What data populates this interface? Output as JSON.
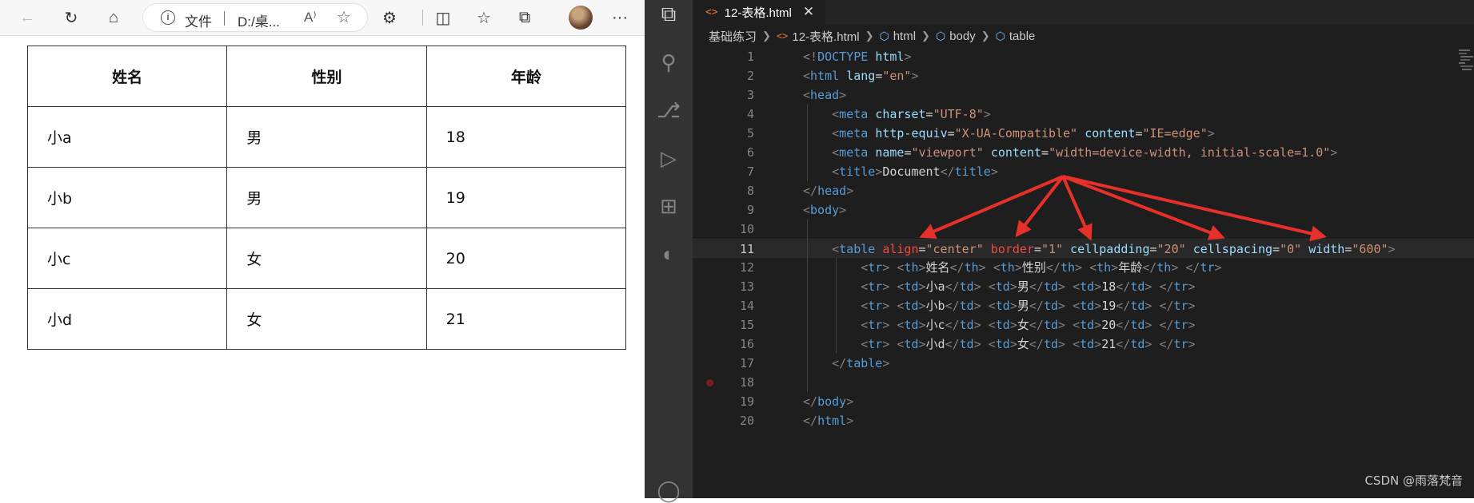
{
  "browser": {
    "toolbar": {
      "back_icon": "←",
      "refresh_icon": "↻",
      "home_icon": "⌂",
      "address_label": "文件",
      "address_url": "D:/桌...",
      "read_aloud_label": "A⁾",
      "favorite_icon": "☆",
      "extensions_icon": "⚙",
      "split_icon": "◫",
      "favorites_icon": "☆",
      "collections_icon": "⧉",
      "more_icon": "···"
    },
    "table": {
      "headers": [
        "姓名",
        "性别",
        "年龄"
      ],
      "rows": [
        [
          "小a",
          "男",
          "18"
        ],
        [
          "小b",
          "男",
          "19"
        ],
        [
          "小c",
          "女",
          "20"
        ],
        [
          "小d",
          "女",
          "21"
        ]
      ]
    }
  },
  "vscode": {
    "tab": {
      "label": "12-表格.html",
      "close": "✕"
    },
    "breadcrumb": [
      "基础练习",
      "12-表格.html",
      "html",
      "body",
      "table"
    ],
    "watermark": "CSDN @雨落梵音",
    "colors": {
      "arrow": "#e8302a",
      "keyword": "#569cd6",
      "attr": "#9cdcfe",
      "string": "#ce9178"
    },
    "lines": [
      {
        "n": "1",
        "tokens": [
          [
            "pn",
            "<!"
          ],
          [
            "tg",
            "DOCTYPE"
          ],
          [
            "tx",
            " "
          ],
          [
            "at",
            "html"
          ],
          [
            "pn",
            ">"
          ]
        ]
      },
      {
        "n": "2",
        "tokens": [
          [
            "pn",
            "<"
          ],
          [
            "tg",
            "html"
          ],
          [
            "tx",
            " "
          ],
          [
            "at",
            "lang"
          ],
          [
            "tx",
            "="
          ],
          [
            "st",
            "\"en\""
          ],
          [
            "pn",
            ">"
          ]
        ]
      },
      {
        "n": "3",
        "tokens": [
          [
            "pn",
            "<"
          ],
          [
            "tg",
            "head"
          ],
          [
            "pn",
            ">"
          ]
        ]
      },
      {
        "n": "4",
        "tokens": [
          [
            "tx",
            "    "
          ],
          [
            "pn",
            "<"
          ],
          [
            "tg",
            "meta"
          ],
          [
            "tx",
            " "
          ],
          [
            "at",
            "charset"
          ],
          [
            "tx",
            "="
          ],
          [
            "st",
            "\"UTF-8\""
          ],
          [
            "pn",
            ">"
          ]
        ]
      },
      {
        "n": "5",
        "tokens": [
          [
            "tx",
            "    "
          ],
          [
            "pn",
            "<"
          ],
          [
            "tg",
            "meta"
          ],
          [
            "tx",
            " "
          ],
          [
            "at",
            "http-equiv"
          ],
          [
            "tx",
            "="
          ],
          [
            "st",
            "\"X-UA-Compatible\""
          ],
          [
            "tx",
            " "
          ],
          [
            "at",
            "content"
          ],
          [
            "tx",
            "="
          ],
          [
            "st",
            "\"IE=edge\""
          ],
          [
            "pn",
            ">"
          ]
        ]
      },
      {
        "n": "6",
        "tokens": [
          [
            "tx",
            "    "
          ],
          [
            "pn",
            "<"
          ],
          [
            "tg",
            "meta"
          ],
          [
            "tx",
            " "
          ],
          [
            "at",
            "name"
          ],
          [
            "tx",
            "="
          ],
          [
            "st",
            "\"viewport\""
          ],
          [
            "tx",
            " "
          ],
          [
            "at",
            "content"
          ],
          [
            "tx",
            "="
          ],
          [
            "st",
            "\"width=device-width, initial-scale=1.0\""
          ],
          [
            "pn",
            ">"
          ]
        ]
      },
      {
        "n": "7",
        "tokens": [
          [
            "tx",
            "    "
          ],
          [
            "pn",
            "<"
          ],
          [
            "tg",
            "title"
          ],
          [
            "pn",
            ">"
          ],
          [
            "tx",
            "Document"
          ],
          [
            "pn",
            "</"
          ],
          [
            "tg",
            "title"
          ],
          [
            "pn",
            ">"
          ]
        ]
      },
      {
        "n": "8",
        "tokens": [
          [
            "pn",
            "</"
          ],
          [
            "tg",
            "head"
          ],
          [
            "pn",
            ">"
          ]
        ]
      },
      {
        "n": "9",
        "tokens": [
          [
            "pn",
            "<"
          ],
          [
            "tg",
            "body"
          ],
          [
            "pn",
            ">"
          ]
        ]
      },
      {
        "n": "10",
        "tokens": []
      },
      {
        "n": "11",
        "tokens": [
          [
            "tx",
            "    "
          ],
          [
            "pn",
            "<"
          ],
          [
            "tg",
            "table"
          ],
          [
            "tx",
            " "
          ],
          [
            "ac",
            "align"
          ],
          [
            "tx",
            "="
          ],
          [
            "st",
            "\"center\""
          ],
          [
            "tx",
            " "
          ],
          [
            "ac",
            "border"
          ],
          [
            "tx",
            "="
          ],
          [
            "st",
            "\"1\""
          ],
          [
            "tx",
            " "
          ],
          [
            "at",
            "cellpadding"
          ],
          [
            "tx",
            "="
          ],
          [
            "st",
            "\"20\""
          ],
          [
            "tx",
            " "
          ],
          [
            "at",
            "cellspacing"
          ],
          [
            "tx",
            "="
          ],
          [
            "st",
            "\"0\""
          ],
          [
            "tx",
            " "
          ],
          [
            "at",
            "width"
          ],
          [
            "tx",
            "="
          ],
          [
            "st",
            "\"600\""
          ],
          [
            "pn",
            ">"
          ]
        ]
      },
      {
        "n": "12",
        "tokens": [
          [
            "tx",
            "        "
          ],
          [
            "pn",
            "<"
          ],
          [
            "tg",
            "tr"
          ],
          [
            "pn",
            ">"
          ],
          [
            "tx",
            " "
          ],
          [
            "pn",
            "<"
          ],
          [
            "tg",
            "th"
          ],
          [
            "pn",
            ">"
          ],
          [
            "tx",
            "姓名"
          ],
          [
            "pn",
            "</"
          ],
          [
            "tg",
            "th"
          ],
          [
            "pn",
            ">"
          ],
          [
            "tx",
            " "
          ],
          [
            "pn",
            "<"
          ],
          [
            "tg",
            "th"
          ],
          [
            "pn",
            ">"
          ],
          [
            "tx",
            "性别"
          ],
          [
            "pn",
            "</"
          ],
          [
            "tg",
            "th"
          ],
          [
            "pn",
            ">"
          ],
          [
            "tx",
            " "
          ],
          [
            "pn",
            "<"
          ],
          [
            "tg",
            "th"
          ],
          [
            "pn",
            ">"
          ],
          [
            "tx",
            "年龄"
          ],
          [
            "pn",
            "</"
          ],
          [
            "tg",
            "th"
          ],
          [
            "pn",
            ">"
          ],
          [
            "tx",
            " "
          ],
          [
            "pn",
            "</"
          ],
          [
            "tg",
            "tr"
          ],
          [
            "pn",
            ">"
          ]
        ]
      },
      {
        "n": "13",
        "tokens": [
          [
            "tx",
            "        "
          ],
          [
            "pn",
            "<"
          ],
          [
            "tg",
            "tr"
          ],
          [
            "pn",
            ">"
          ],
          [
            "tx",
            " "
          ],
          [
            "pn",
            "<"
          ],
          [
            "tg",
            "td"
          ],
          [
            "pn",
            ">"
          ],
          [
            "tx",
            "小a"
          ],
          [
            "pn",
            "</"
          ],
          [
            "tg",
            "td"
          ],
          [
            "pn",
            ">"
          ],
          [
            "tx",
            " "
          ],
          [
            "pn",
            "<"
          ],
          [
            "tg",
            "td"
          ],
          [
            "pn",
            ">"
          ],
          [
            "tx",
            "男"
          ],
          [
            "pn",
            "</"
          ],
          [
            "tg",
            "td"
          ],
          [
            "pn",
            ">"
          ],
          [
            "tx",
            " "
          ],
          [
            "pn",
            "<"
          ],
          [
            "tg",
            "td"
          ],
          [
            "pn",
            ">"
          ],
          [
            "tx",
            "18"
          ],
          [
            "pn",
            "</"
          ],
          [
            "tg",
            "td"
          ],
          [
            "pn",
            ">"
          ],
          [
            "tx",
            " "
          ],
          [
            "pn",
            "</"
          ],
          [
            "tg",
            "tr"
          ],
          [
            "pn",
            ">"
          ]
        ]
      },
      {
        "n": "14",
        "tokens": [
          [
            "tx",
            "        "
          ],
          [
            "pn",
            "<"
          ],
          [
            "tg",
            "tr"
          ],
          [
            "pn",
            ">"
          ],
          [
            "tx",
            " "
          ],
          [
            "pn",
            "<"
          ],
          [
            "tg",
            "td"
          ],
          [
            "pn",
            ">"
          ],
          [
            "tx",
            "小b"
          ],
          [
            "pn",
            "</"
          ],
          [
            "tg",
            "td"
          ],
          [
            "pn",
            ">"
          ],
          [
            "tx",
            " "
          ],
          [
            "pn",
            "<"
          ],
          [
            "tg",
            "td"
          ],
          [
            "pn",
            ">"
          ],
          [
            "tx",
            "男"
          ],
          [
            "pn",
            "</"
          ],
          [
            "tg",
            "td"
          ],
          [
            "pn",
            ">"
          ],
          [
            "tx",
            " "
          ],
          [
            "pn",
            "<"
          ],
          [
            "tg",
            "td"
          ],
          [
            "pn",
            ">"
          ],
          [
            "tx",
            "19"
          ],
          [
            "pn",
            "</"
          ],
          [
            "tg",
            "td"
          ],
          [
            "pn",
            ">"
          ],
          [
            "tx",
            " "
          ],
          [
            "pn",
            "</"
          ],
          [
            "tg",
            "tr"
          ],
          [
            "pn",
            ">"
          ]
        ]
      },
      {
        "n": "15",
        "tokens": [
          [
            "tx",
            "        "
          ],
          [
            "pn",
            "<"
          ],
          [
            "tg",
            "tr"
          ],
          [
            "pn",
            ">"
          ],
          [
            "tx",
            " "
          ],
          [
            "pn",
            "<"
          ],
          [
            "tg",
            "td"
          ],
          [
            "pn",
            ">"
          ],
          [
            "tx",
            "小c"
          ],
          [
            "pn",
            "</"
          ],
          [
            "tg",
            "td"
          ],
          [
            "pn",
            ">"
          ],
          [
            "tx",
            " "
          ],
          [
            "pn",
            "<"
          ],
          [
            "tg",
            "td"
          ],
          [
            "pn",
            ">"
          ],
          [
            "tx",
            "女"
          ],
          [
            "pn",
            "</"
          ],
          [
            "tg",
            "td"
          ],
          [
            "pn",
            ">"
          ],
          [
            "tx",
            " "
          ],
          [
            "pn",
            "<"
          ],
          [
            "tg",
            "td"
          ],
          [
            "pn",
            ">"
          ],
          [
            "tx",
            "20"
          ],
          [
            "pn",
            "</"
          ],
          [
            "tg",
            "td"
          ],
          [
            "pn",
            ">"
          ],
          [
            "tx",
            " "
          ],
          [
            "pn",
            "</"
          ],
          [
            "tg",
            "tr"
          ],
          [
            "pn",
            ">"
          ]
        ]
      },
      {
        "n": "16",
        "tokens": [
          [
            "tx",
            "        "
          ],
          [
            "pn",
            "<"
          ],
          [
            "tg",
            "tr"
          ],
          [
            "pn",
            ">"
          ],
          [
            "tx",
            " "
          ],
          [
            "pn",
            "<"
          ],
          [
            "tg",
            "td"
          ],
          [
            "pn",
            ">"
          ],
          [
            "tx",
            "小d"
          ],
          [
            "pn",
            "</"
          ],
          [
            "tg",
            "td"
          ],
          [
            "pn",
            ">"
          ],
          [
            "tx",
            " "
          ],
          [
            "pn",
            "<"
          ],
          [
            "tg",
            "td"
          ],
          [
            "pn",
            ">"
          ],
          [
            "tx",
            "女"
          ],
          [
            "pn",
            "</"
          ],
          [
            "tg",
            "td"
          ],
          [
            "pn",
            ">"
          ],
          [
            "tx",
            " "
          ],
          [
            "pn",
            "<"
          ],
          [
            "tg",
            "td"
          ],
          [
            "pn",
            ">"
          ],
          [
            "tx",
            "21"
          ],
          [
            "pn",
            "</"
          ],
          [
            "tg",
            "td"
          ],
          [
            "pn",
            ">"
          ],
          [
            "tx",
            " "
          ],
          [
            "pn",
            "</"
          ],
          [
            "tg",
            "tr"
          ],
          [
            "pn",
            ">"
          ]
        ]
      },
      {
        "n": "17",
        "tokens": [
          [
            "tx",
            "    "
          ],
          [
            "pn",
            "</"
          ],
          [
            "tg",
            "table"
          ],
          [
            "pn",
            ">"
          ]
        ]
      },
      {
        "n": "18",
        "tokens": []
      },
      {
        "n": "19",
        "tokens": [
          [
            "pn",
            "</"
          ],
          [
            "tg",
            "body"
          ],
          [
            "pn",
            ">"
          ]
        ]
      },
      {
        "n": "20",
        "tokens": [
          [
            "pn",
            "</"
          ],
          [
            "tg",
            "html"
          ],
          [
            "pn",
            ">"
          ]
        ]
      }
    ]
  }
}
